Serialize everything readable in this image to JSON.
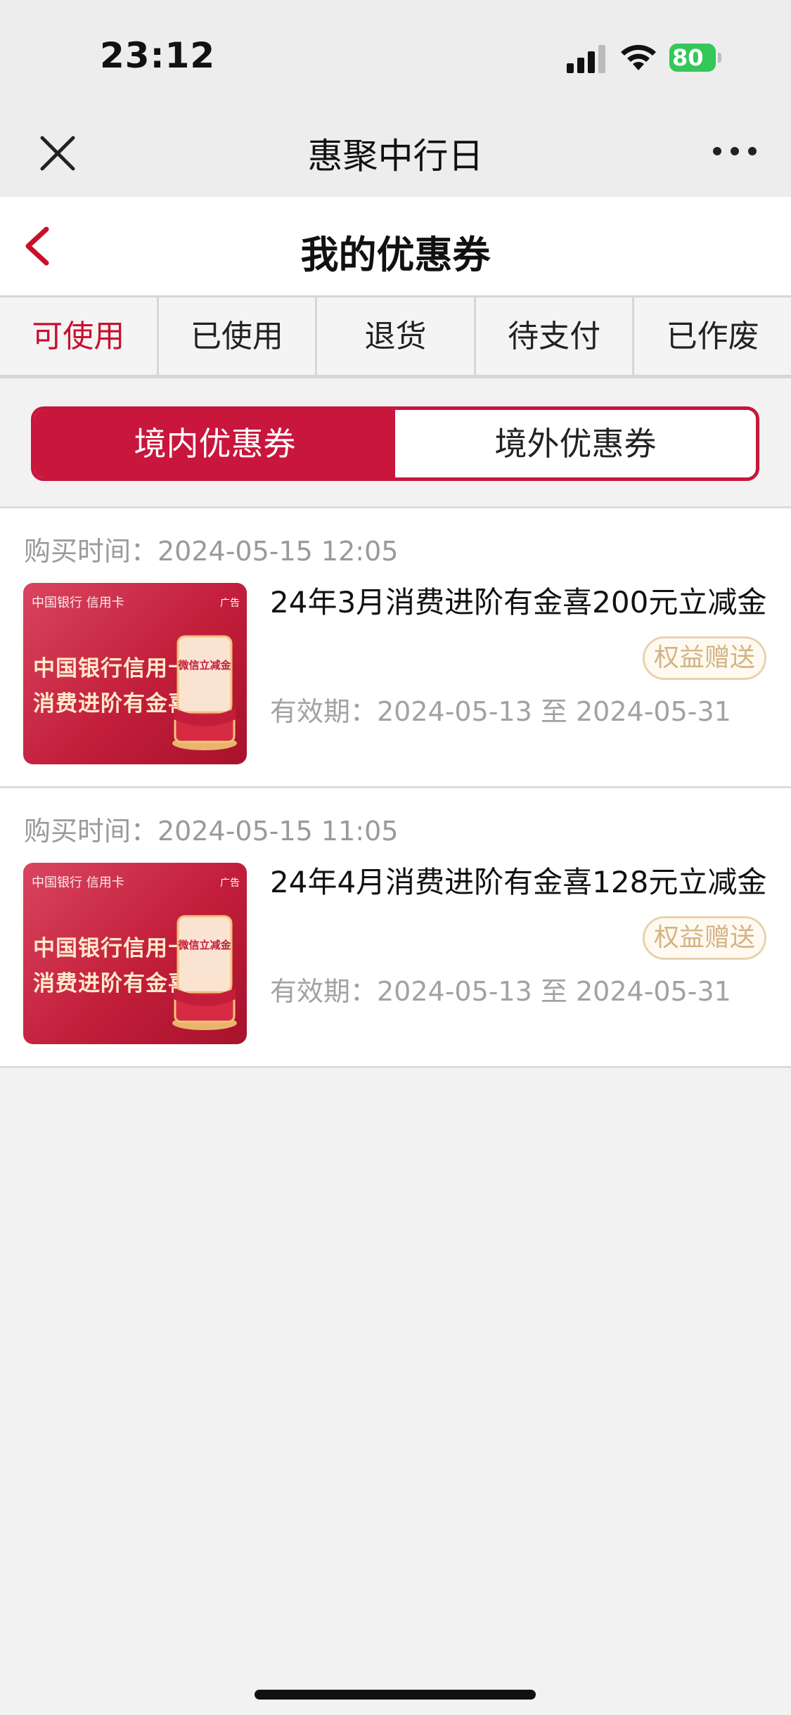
{
  "status_bar": {
    "time": "23:12",
    "battery": "80"
  },
  "mini_program": {
    "title": "惠聚中行日"
  },
  "page": {
    "title": "我的优惠券"
  },
  "tabs": [
    {
      "label": "可使用",
      "active": true
    },
    {
      "label": "已使用",
      "active": false
    },
    {
      "label": "退货",
      "active": false
    },
    {
      "label": "待支付",
      "active": false
    },
    {
      "label": "已作废",
      "active": false
    }
  ],
  "segment": {
    "domestic": "境内优惠券",
    "overseas": "境外优惠券"
  },
  "coupons": [
    {
      "buy_time": "购买时间：2024-05-15 12:05",
      "title": "24年3月消费进阶有金喜200元立减金",
      "tag": "权益赠送",
      "validity": "有效期：2024-05-13 至 2024-05-31",
      "thumb": {
        "logo": "中国银行 信用卡",
        "ad": "广告",
        "line1": "中国银行信用卡",
        "line2": "消费进阶有金喜",
        "box": "微信立减金"
      }
    },
    {
      "buy_time": "购买时间：2024-05-15 11:05",
      "title": "24年4月消费进阶有金喜128元立减金",
      "tag": "权益赠送",
      "validity": "有效期：2024-05-13 至 2024-05-31",
      "thumb": {
        "logo": "中国银行 信用卡",
        "ad": "广告",
        "line1": "中国银行信用卡",
        "line2": "消费进阶有金喜",
        "box": "微信立减金"
      }
    }
  ],
  "colors": {
    "brand_red": "#c8163c",
    "tag_gold": "#d4b385",
    "battery_green": "#34c759"
  }
}
